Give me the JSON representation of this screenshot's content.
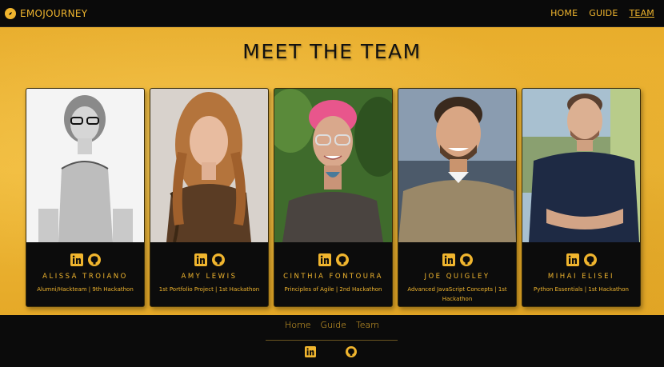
{
  "nav": {
    "brand": "EMOJOURNEY",
    "links": [
      "HOME",
      "GUIDE",
      "TEAM"
    ]
  },
  "page": {
    "title": "MEET THE TEAM"
  },
  "team": [
    {
      "name": "ALISSA TROIANO",
      "desc": "Alumni/Hackteam | 9th Hackathon"
    },
    {
      "name": "AMY LEWIS",
      "desc": "1st Portfolio Project | 1st Hackathon"
    },
    {
      "name": "CINTHIA FONTOURA",
      "desc": "Principles of Agile | 2nd Hackathon"
    },
    {
      "name": "JOE QUIGLEY",
      "desc": "Advanced JavaScript Concepts | 1st Hackathon"
    },
    {
      "name": "MIHAI ELISEI",
      "desc": "Python Essentials | 1st Hackathon"
    }
  ],
  "footer": {
    "links": [
      "Home",
      "Guide",
      "Team"
    ]
  },
  "colors": {
    "accent": "#f0b52e",
    "background": "#0b0b0b",
    "hero": "#efb938"
  },
  "icons": [
    "compass-icon",
    "linkedin-icon",
    "github-icon"
  ]
}
